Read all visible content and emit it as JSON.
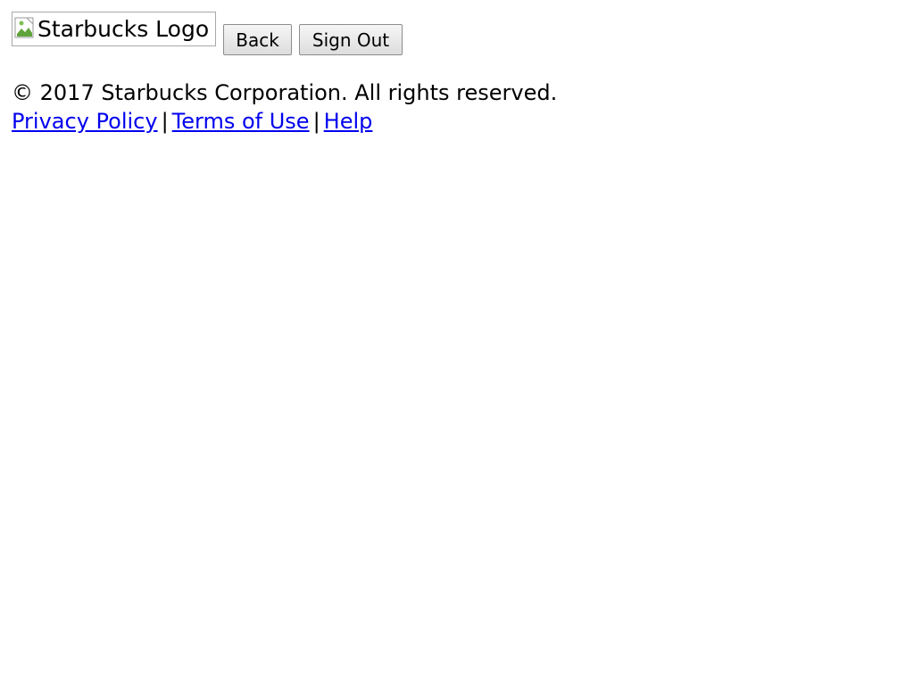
{
  "header": {
    "logo_alt": "Starbucks Logo",
    "back_label": "Back",
    "signout_label": "Sign Out"
  },
  "footer": {
    "copyright": "© 2017 Starbucks Corporation. All rights reserved.",
    "links": [
      {
        "label": "Privacy Policy"
      },
      {
        "label": "Terms of Use"
      },
      {
        "label": "Help"
      }
    ],
    "separator": "|"
  },
  "colors": {
    "link": "#0000ee",
    "text": "#000000",
    "background": "#ffffff"
  },
  "icons": {
    "logo_placeholder": "broken-image-icon"
  }
}
